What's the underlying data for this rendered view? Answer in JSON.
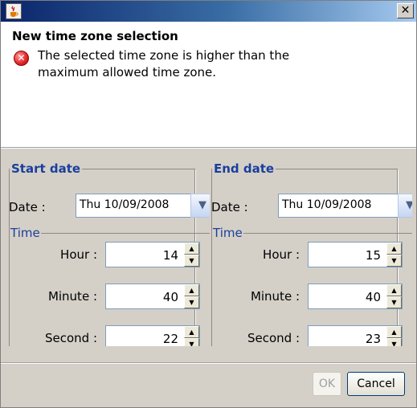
{
  "window": {
    "close_symbol": "✕",
    "icon": "java-coffee-icon"
  },
  "header": {
    "title": "New time zone selection",
    "error_icon": "error-x-icon",
    "message": "The selected time zone is higher than the maximum allowed time zone."
  },
  "start": {
    "legend": "Start date",
    "date_label": "Date :",
    "date_value": "Thu 10/09/2008",
    "time_legend": "Time",
    "hour_label": "Hour :",
    "hour_value": "14",
    "minute_label": "Minute :",
    "minute_value": "40",
    "second_label": "Second :",
    "second_value": "22"
  },
  "end": {
    "legend": "End date",
    "date_label": "Date :",
    "date_value": "Thu 10/09/2008",
    "time_legend": "Time",
    "hour_label": "Hour :",
    "hour_value": "15",
    "minute_label": "Minute :",
    "minute_value": "40",
    "second_label": "Second :",
    "second_value": "23"
  },
  "buttons": {
    "ok": "OK",
    "cancel": "Cancel"
  }
}
